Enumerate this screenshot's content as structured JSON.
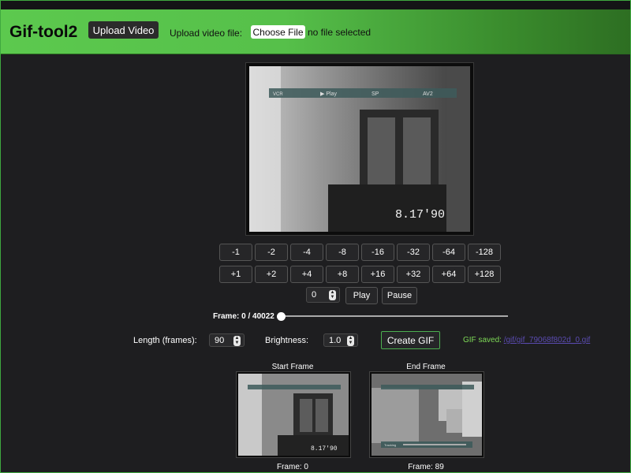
{
  "header": {
    "brand": "Gif-tool2",
    "upload_button": "Upload Video",
    "file_label": "Upload video file:",
    "choose_button": "Choose File",
    "file_status": "no file selected"
  },
  "video": {
    "osd_vcr": "VCR",
    "osd_play": "▶ Play",
    "osd_sp": "SP",
    "osd_av": "AV2",
    "osd_date": "8.17'90"
  },
  "step_back": [
    "-1",
    "-2",
    "-4",
    "-8",
    "-16",
    "-32",
    "-64",
    "-128"
  ],
  "step_fwd": [
    "+1",
    "+2",
    "+4",
    "+8",
    "+16",
    "+32",
    "+64",
    "+128"
  ],
  "playback": {
    "frame_input": "0",
    "play": "Play",
    "pause": "Pause"
  },
  "frame_status": "Frame: 0 / 40022",
  "frame_progress": 0,
  "options": {
    "length_label": "Length (frames):",
    "length_value": "90",
    "brightness_label": "Brightness:",
    "brightness_value": "1.0",
    "create_button": "Create GIF",
    "saved_label": "GIF saved:",
    "saved_link": "/gif/gif_79068f802d_0.gif"
  },
  "thumbs": {
    "start_title": "Start Frame",
    "end_title": "End Frame",
    "start_caption": "Frame: 0",
    "end_caption": "Frame: 89",
    "start_osd_date": "8.17'90",
    "end_osd_tracking": "Tracking"
  }
}
